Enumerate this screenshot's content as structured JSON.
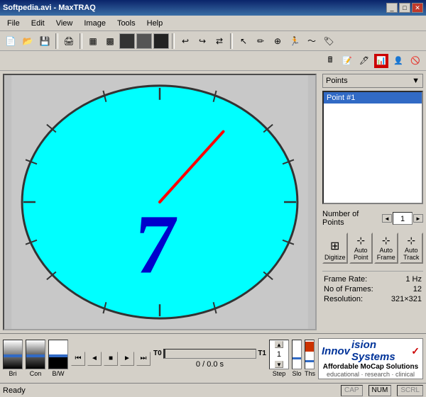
{
  "window": {
    "title": "Softpedia.avi - MaxTRAQ"
  },
  "menu": {
    "items": [
      "File",
      "Edit",
      "View",
      "Image",
      "Tools",
      "Help"
    ]
  },
  "points_panel": {
    "header": "Points",
    "items": [
      "Point #1"
    ],
    "selected": 0,
    "num_points_label": "Number of Points",
    "num_points_value": "1"
  },
  "action_buttons": [
    {
      "icon": "⊞",
      "label": "Digitize"
    },
    {
      "icon": "⊹",
      "label": "Auto Point"
    },
    {
      "icon": "⊹",
      "label": "Auto Frame"
    },
    {
      "icon": "⊹",
      "label": "Auto Track"
    }
  ],
  "info": {
    "frame_rate_label": "Frame Rate:",
    "frame_rate_value": "1 Hz",
    "num_frames_label": "No of Frames:",
    "num_frames_value": "12",
    "resolution_label": "Resolution:",
    "resolution_value": "321×321"
  },
  "sliders": {
    "bri_label": "Bri",
    "con_label": "Con",
    "bw_label": "B/W"
  },
  "playback": {
    "t0_label": "T0",
    "t1_label": "T1",
    "frame_info": "0 / 0.0 s",
    "step_value": "1",
    "step_label": "Step",
    "slo_label": "Slo",
    "ths_label": "Ths"
  },
  "logo": {
    "company": "Innovision Systems",
    "tagline1": "Affordable MoCap Solutions",
    "tagline2": "educational · research · clinical"
  },
  "statusbar": {
    "text": "Ready",
    "cap": "CAP",
    "num": "NUM",
    "scrl": "SCRL"
  }
}
